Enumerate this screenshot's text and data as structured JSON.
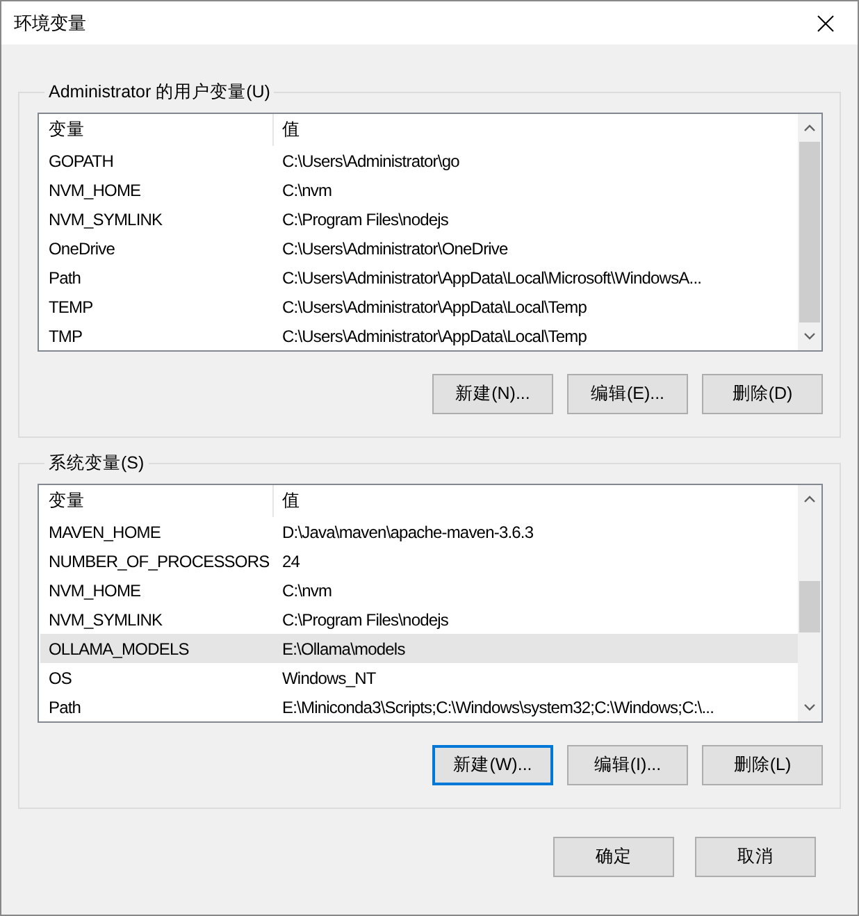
{
  "window": {
    "title": "环境变量"
  },
  "groups": [
    {
      "title": "Administrator 的用户变量(U)",
      "table": {
        "columns": [
          "变量",
          "值"
        ],
        "rows": [
          {
            "name": "GOPATH",
            "value": "C:\\Users\\Administrator\\go",
            "selected": false
          },
          {
            "name": "NVM_HOME",
            "value": "C:\\nvm",
            "selected": false
          },
          {
            "name": "NVM_SYMLINK",
            "value": "C:\\Program Files\\nodejs",
            "selected": false
          },
          {
            "name": "OneDrive",
            "value": "C:\\Users\\Administrator\\OneDrive",
            "selected": false
          },
          {
            "name": "Path",
            "value": "C:\\Users\\Administrator\\AppData\\Local\\Microsoft\\WindowsA...",
            "selected": false
          },
          {
            "name": "TEMP",
            "value": "C:\\Users\\Administrator\\AppData\\Local\\Temp",
            "selected": false
          },
          {
            "name": "TMP",
            "value": "C:\\Users\\Administrator\\AppData\\Local\\Temp",
            "selected": false
          }
        ]
      },
      "buttons": [
        {
          "label": "新建(N)...",
          "focused": false
        },
        {
          "label": "编辑(E)...",
          "focused": false
        },
        {
          "label": "删除(D)",
          "focused": false
        }
      ]
    },
    {
      "title": "系统变量(S)",
      "table": {
        "columns": [
          "变量",
          "值"
        ],
        "rows": [
          {
            "name": "MAVEN_HOME",
            "value": "D:\\Java\\maven\\apache-maven-3.6.3",
            "selected": false
          },
          {
            "name": "NUMBER_OF_PROCESSORS",
            "value": "24",
            "selected": false
          },
          {
            "name": "NVM_HOME",
            "value": "C:\\nvm",
            "selected": false
          },
          {
            "name": "NVM_SYMLINK",
            "value": "C:\\Program Files\\nodejs",
            "selected": false
          },
          {
            "name": "OLLAMA_MODELS",
            "value": "E:\\Ollama\\models",
            "selected": true
          },
          {
            "name": "OS",
            "value": "Windows_NT",
            "selected": false
          },
          {
            "name": "Path",
            "value": "E:\\Miniconda3\\Scripts;C:\\Windows\\system32;C:\\Windows;C:\\...",
            "selected": false
          }
        ]
      },
      "buttons": [
        {
          "label": "新建(W)...",
          "focused": true
        },
        {
          "label": "编辑(I)...",
          "focused": false
        },
        {
          "label": "删除(L)",
          "focused": false
        }
      ]
    }
  ],
  "footer_buttons": [
    {
      "label": "确定",
      "focused": false
    },
    {
      "label": "取消",
      "focused": false
    }
  ]
}
